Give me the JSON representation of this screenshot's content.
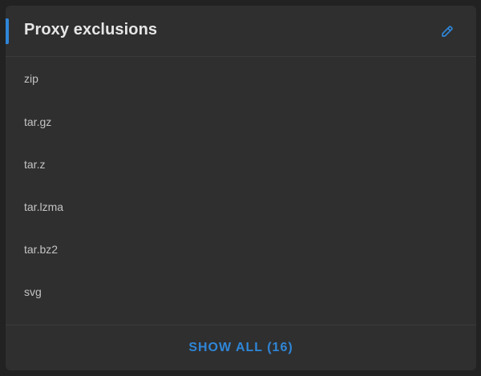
{
  "card": {
    "title": "Proxy exclusions",
    "edit_icon": "pencil-icon",
    "accent_color": "#2f86d8",
    "items": [
      {
        "label": "zip"
      },
      {
        "label": "tar.gz"
      },
      {
        "label": "tar.z"
      },
      {
        "label": "tar.lzma"
      },
      {
        "label": "tar.bz2"
      },
      {
        "label": "svg"
      }
    ],
    "show_all_label": "SHOW ALL (16)"
  }
}
